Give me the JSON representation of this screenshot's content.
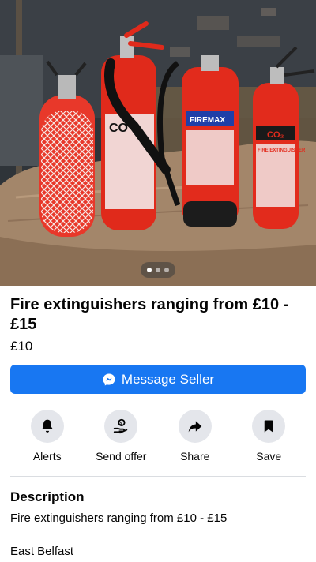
{
  "listing": {
    "photo_alt": "Photo of four red fire extinguishers on a wooden table",
    "photo_labels": {
      "co2_big": "CO",
      "foam_brand": "FIREMAX",
      "co2_small": "CO₂",
      "fire_ext": "FIRE EXTINGUISHER"
    },
    "carousel": {
      "count": 3,
      "active": 1
    },
    "title": "Fire extinguishers ranging from £10 - £15",
    "price": "£10"
  },
  "message_button": {
    "label": "Message Seller"
  },
  "actions": [
    {
      "label": "Alerts",
      "icon": "bell-icon"
    },
    {
      "label": "Send offer",
      "icon": "offer-icon"
    },
    {
      "label": "Share",
      "icon": "share-icon"
    },
    {
      "label": "Save",
      "icon": "bookmark-icon"
    }
  ],
  "description": {
    "heading": "Description",
    "text": "Fire extinguishers ranging from £10 - £15",
    "location": "East Belfast"
  },
  "colors": {
    "accent": "#1877f2",
    "button_circle": "#e4e6eb",
    "extinguisher_red": "#e02a1b"
  }
}
